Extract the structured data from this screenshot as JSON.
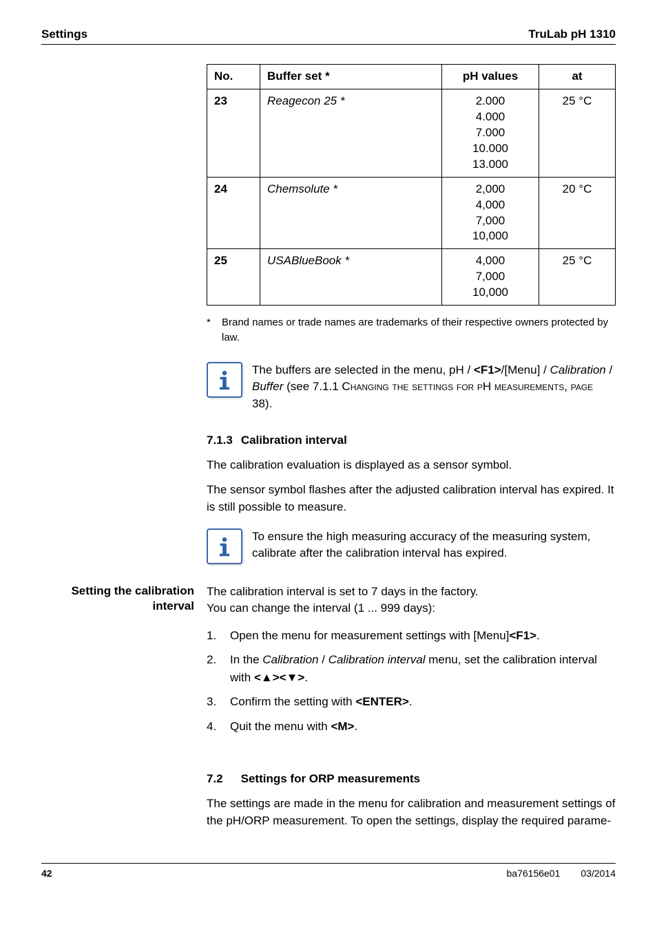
{
  "header": {
    "left": "Settings",
    "right": "TruLab pH 1310"
  },
  "table": {
    "head": {
      "no": "No.",
      "name": "Buffer set *",
      "ph": "pH values",
      "at": "at"
    },
    "rows": [
      {
        "no": "23",
        "name": "Reagecon 25 *",
        "ph": "2.000\n4.000\n7.000\n10.000\n13.000",
        "at": "25  °C"
      },
      {
        "no": "24",
        "name": "Chemsolute *",
        "ph": "2,000\n4,000\n7,000\n10,000",
        "at": "20 °C"
      },
      {
        "no": "25",
        "name": "USABlueBook *",
        "ph": "4,000\n7,000\n10,000",
        "at": "25 °C"
      }
    ]
  },
  "footnote": {
    "star": "*",
    "text": "Brand names or trade names are trademarks of their respective owners protected by law."
  },
  "info1": {
    "pre": "The buffers are selected in the menu, pH / ",
    "key": "<F1>",
    "mid": "/[Menu] / ",
    "cal": "Calibration",
    "slash": " / ",
    "buf": "Buffer",
    "see": " (see 7.1.1 ",
    "caps": "Changing the settings for pH measurements, page",
    "pg": " 38)."
  },
  "section713": {
    "num": "7.1.3",
    "title": "Calibration interval",
    "p1": "The calibration evaluation is displayed as a sensor symbol.",
    "p2": "The sensor symbol flashes after the adjusted calibration interval has expired. It is still possible to measure."
  },
  "info2": "To ensure the high measuring accuracy of the measuring system, calibrate after the calibration interval has expired.",
  "sidelabel": "Setting the calibration interval",
  "sidebody": {
    "l1": "The calibration interval is set to 7 days in the factory.",
    "l2": "You can change the interval (1 ... 999 days):"
  },
  "steps": [
    {
      "pre": "Open the menu for measurement settings with [Menu]",
      "key": "<F1>",
      "post": "."
    },
    {
      "pre": "In the ",
      "i1": "Calibration",
      "mid": " / ",
      "i2": "Calibration interval",
      "post": " menu, set the calibration interval with ",
      "keys": "<▲><▼>",
      "end": "."
    },
    {
      "pre": "Confirm the setting with ",
      "key": "<ENTER>",
      "post": "."
    },
    {
      "pre": "Quit the menu with ",
      "key": "<M>",
      "post": "."
    }
  ],
  "section72": {
    "num": "7.2",
    "title": "Settings for ORP measurements",
    "p": "The settings are made in the menu for calibration and measurement settings of the pH/ORP measurement. To open the settings, display the required parame-"
  },
  "footer": {
    "page": "42",
    "code": "ba76156e01",
    "date": "03/2014"
  }
}
